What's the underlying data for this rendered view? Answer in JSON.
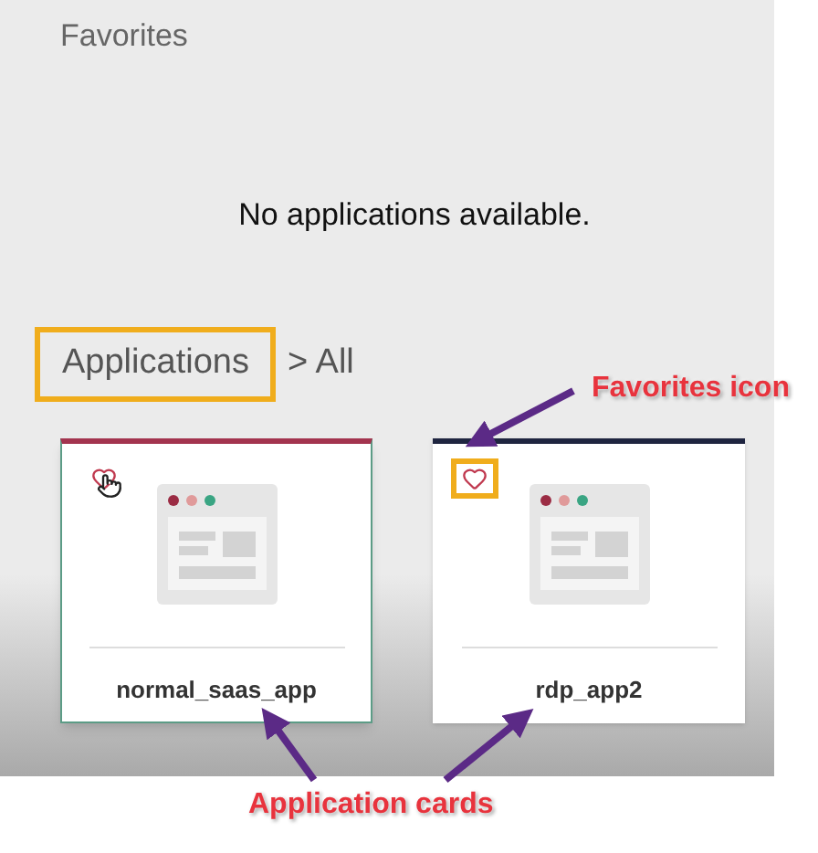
{
  "favorites": {
    "title": "Favorites",
    "empty_message": "No applications available."
  },
  "breadcrumb": [
    {
      "label": "Applications",
      "highlighted": true
    },
    {
      "label": "> All",
      "highlighted": false
    }
  ],
  "cards": [
    {
      "name": "normal_saas_app",
      "color": "#a3344f",
      "hovered": true,
      "heart_highlighted": false
    },
    {
      "name": "rdp_app2",
      "color": "#1f2540",
      "hovered": false,
      "heart_highlighted": true
    }
  ],
  "annotations": [
    {
      "label": "Favorites icon",
      "kind": "favorites"
    },
    {
      "label": "Application cards",
      "kind": "cards"
    }
  ]
}
